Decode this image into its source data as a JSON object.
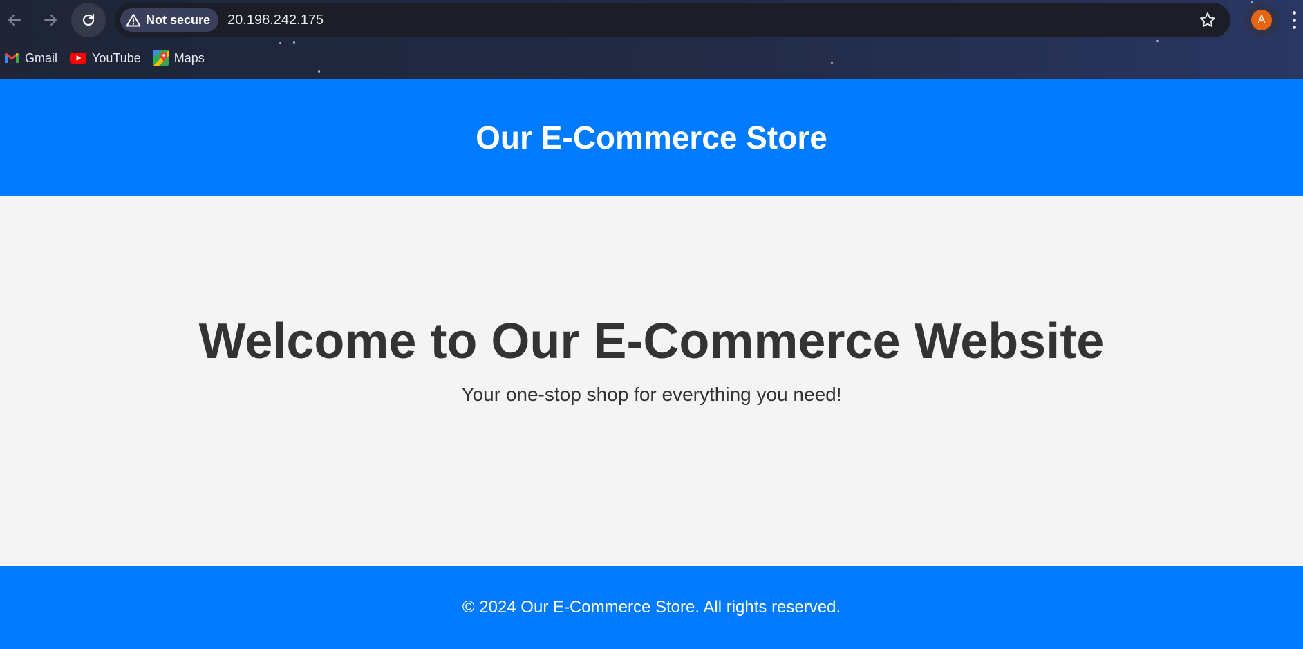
{
  "browser": {
    "security_label": "Not secure",
    "url": "20.198.242.175",
    "profile_initial": "A",
    "bookmarks": [
      {
        "label": "Gmail",
        "icon": "gmail-icon"
      },
      {
        "label": "YouTube",
        "icon": "youtube-icon"
      },
      {
        "label": "Maps",
        "icon": "maps-icon"
      }
    ]
  },
  "header": {
    "title": "Our E-Commerce Store"
  },
  "hero": {
    "heading": "Welcome to Our E-Commerce Website",
    "subtitle": "Your one-stop shop for everything you need!"
  },
  "footer": {
    "text": "© 2024 Our E-Commerce Store. All rights reserved."
  },
  "colors": {
    "brand_blue": "#007bff",
    "page_background": "#f4f4f4",
    "text_dark": "#333333",
    "profile_orange": "#e8650f"
  }
}
